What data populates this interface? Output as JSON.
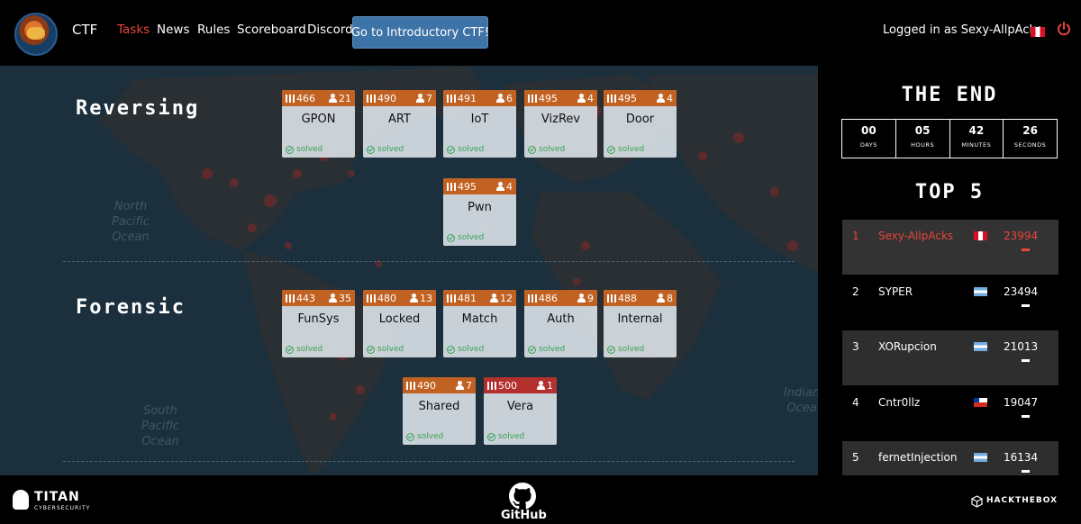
{
  "nav": {
    "brand": "CTF",
    "links": [
      "Tasks",
      "News",
      "Rules",
      "Scoreboard",
      "Discord"
    ],
    "intro_button": "Go to Introductory CTF!",
    "login_status": "Logged in as Sexy-AllpAcks",
    "active_link": "Tasks"
  },
  "map_labels": {
    "north_pacific": "North\nPacific\nOcean",
    "south_pacific": "South\nPacific\nOcean",
    "indian": "Indian\nOcea"
  },
  "sections": {
    "reversing": {
      "title": "Reversing",
      "tasks": [
        {
          "name": "GPON",
          "points": "466",
          "solves": "21",
          "status": "solved"
        },
        {
          "name": "ART",
          "points": "490",
          "solves": "7",
          "status": "solved"
        },
        {
          "name": "IoT",
          "points": "491",
          "solves": "6",
          "status": "solved"
        },
        {
          "name": "VizRev",
          "points": "495",
          "solves": "4",
          "status": "solved"
        },
        {
          "name": "Door",
          "points": "495",
          "solves": "4",
          "status": "solved"
        },
        {
          "name": "Pwn",
          "points": "495",
          "solves": "4",
          "status": "solved"
        }
      ]
    },
    "forensic": {
      "title": "Forensic",
      "tasks": [
        {
          "name": "FunSys",
          "points": "443",
          "solves": "35",
          "status": "solved"
        },
        {
          "name": "Locked",
          "points": "480",
          "solves": "13",
          "status": "solved"
        },
        {
          "name": "Match",
          "points": "481",
          "solves": "12",
          "status": "solved"
        },
        {
          "name": "Auth",
          "points": "486",
          "solves": "9",
          "status": "solved"
        },
        {
          "name": "Internal",
          "points": "488",
          "solves": "8",
          "status": "solved"
        },
        {
          "name": "Shared",
          "points": "490",
          "solves": "7",
          "status": "solved"
        },
        {
          "name": "Vera",
          "points": "500",
          "solves": "1",
          "status": "solved"
        }
      ]
    }
  },
  "countdown": {
    "title": "THE END",
    "units": [
      {
        "value": "00",
        "label": "DAYS"
      },
      {
        "value": "05",
        "label": "HOURS"
      },
      {
        "value": "42",
        "label": "MINUTES"
      },
      {
        "value": "26",
        "label": "SECONDS"
      }
    ]
  },
  "leaderboard": {
    "title": "TOP 5",
    "rows": [
      {
        "rank": "1",
        "team": "Sexy-AllpAcks",
        "flag": "peru-flag-icon",
        "score": "23994"
      },
      {
        "rank": "2",
        "team": "SYPER",
        "flag": "argentina-flag-icon",
        "score": "23494"
      },
      {
        "rank": "3",
        "team": "XORupcion",
        "flag": "argentina-flag-icon",
        "score": "21013"
      },
      {
        "rank": "4",
        "team": "Cntr0llz",
        "flag": "chile-flag-icon",
        "score": "19047"
      },
      {
        "rank": "5",
        "team": "fernetInjection",
        "flag": "argentina-flag-icon",
        "score": "16134"
      }
    ]
  },
  "footer": {
    "titan": "TITAN",
    "titan_sub": "CYBERSECURITY",
    "github": "GitHub",
    "htb": "HACKTHEBOX"
  },
  "colors": {
    "accent_red": "#e8453c",
    "card_header": "#c26222",
    "card_header_unsolved": "#b3302f",
    "intro_button": "#3d73a7",
    "map_bg": "#1b2f3d",
    "solved_green": "#3aa355"
  }
}
